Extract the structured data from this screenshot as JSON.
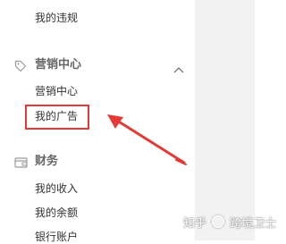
{
  "sidebar": {
    "top_item": {
      "label": "我的违规"
    },
    "sections": [
      {
        "title": "营销中心",
        "icon": "tag-icon",
        "expanded": true,
        "items": [
          {
            "label": "营销中心"
          },
          {
            "label": "我的广告",
            "highlighted": true
          }
        ]
      },
      {
        "title": "财务",
        "icon": "wallet-icon",
        "items": [
          {
            "label": "我的收入"
          },
          {
            "label": "我的余额"
          },
          {
            "label": "银行账户"
          }
        ]
      }
    ]
  },
  "annotation": {
    "color": "#e53935"
  },
  "watermark": {
    "text_left": "知乎",
    "text_right": "跨境卫士"
  }
}
